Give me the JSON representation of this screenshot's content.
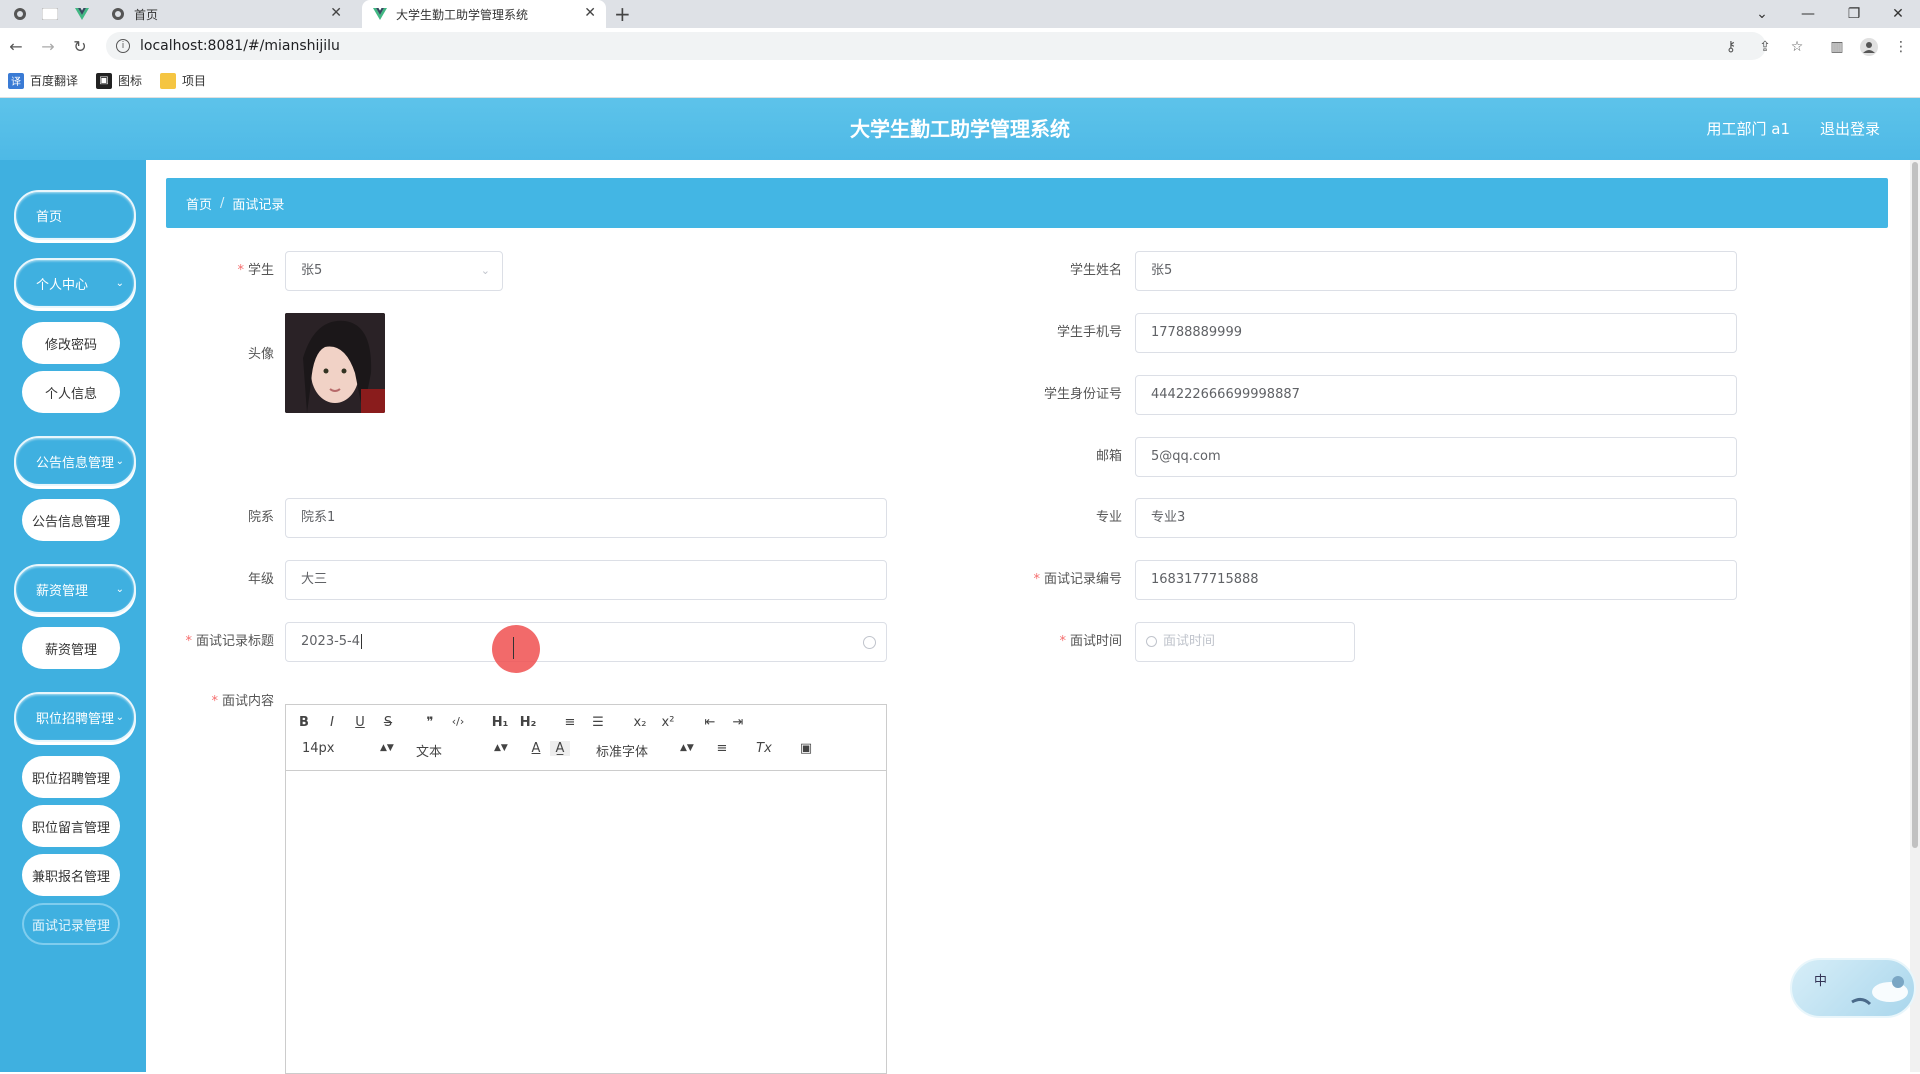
{
  "browser": {
    "tabs": [
      {
        "label": "首页",
        "active": false
      },
      {
        "label": "大学生勤工助学管理系统",
        "active": true
      }
    ],
    "new_tab_label": "+",
    "url": "localhost:8081/#/mianshijilu",
    "bookmarks": [
      {
        "label": "百度翻译",
        "icon": "translate-icon",
        "color": "#3a7bd5"
      },
      {
        "label": "图标",
        "icon": "image-icon",
        "color": "#222222"
      },
      {
        "label": "项目",
        "icon": "folder-icon",
        "color": "#f5c542"
      }
    ]
  },
  "header": {
    "title": "大学生勤工助学管理系统",
    "user": "用工部门 a1",
    "logout": "退出登录"
  },
  "sidebar": {
    "home": "首页",
    "groups": [
      {
        "label": "个人中心",
        "items": [
          "修改密码",
          "个人信息"
        ]
      },
      {
        "label": "公告信息管理",
        "items": [
          "公告信息管理"
        ]
      },
      {
        "label": "薪资管理",
        "items": [
          "薪资管理"
        ]
      },
      {
        "label": "职位招聘管理",
        "items": [
          "职位招聘管理",
          "职位留言管理",
          "兼职报名管理",
          "面试记录管理"
        ]
      }
    ]
  },
  "breadcrumb": {
    "home": "首页",
    "sep": "/",
    "current": "面试记录"
  },
  "form": {
    "student": {
      "label": "学生",
      "value": "张5"
    },
    "avatar": {
      "label": "头像"
    },
    "student_name": {
      "label": "学生姓名",
      "value": "张5"
    },
    "student_phone": {
      "label": "学生手机号",
      "value": "17788889999"
    },
    "student_id_card": {
      "label": "学生身份证号",
      "value": "444222666699998887"
    },
    "email": {
      "label": "邮箱",
      "value": "5@qq.com"
    },
    "department": {
      "label": "院系",
      "value": "院系1"
    },
    "major": {
      "label": "专业",
      "value": "专业3"
    },
    "grade": {
      "label": "年级",
      "value": "大三"
    },
    "record_no": {
      "label": "面试记录编号",
      "value": "1683177715888"
    },
    "record_title": {
      "label": "面试记录标题",
      "value": "2023-5-4"
    },
    "interview_time": {
      "label": "面试时间",
      "placeholder": "面试时间"
    },
    "content": {
      "label": "面试内容"
    }
  },
  "editor": {
    "toolbar_row1": [
      "B",
      "I",
      "U",
      "S",
      "❞",
      "‹/›",
      "H₁",
      "H₂",
      "≡",
      "☰",
      "x₂",
      "x²",
      "⇤",
      "⇥"
    ],
    "font_size": "14px",
    "header_select": "文本",
    "font_family": "标准字体",
    "toolbar_row2_icons": [
      "A",
      "A̲",
      "≡",
      "Tx",
      "▣"
    ]
  },
  "widget": {
    "label": "中"
  }
}
